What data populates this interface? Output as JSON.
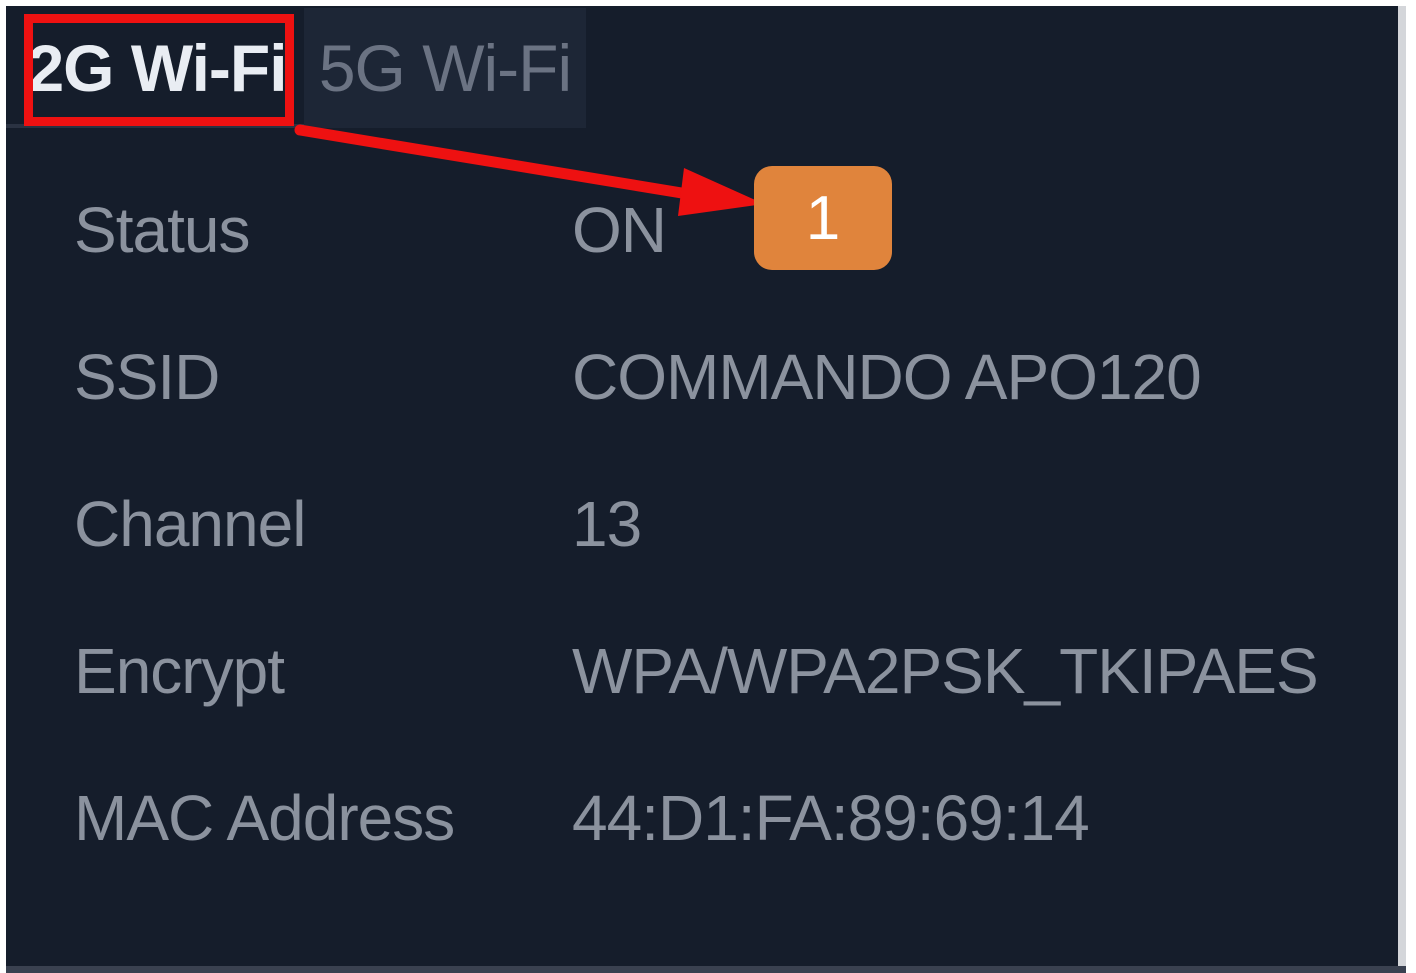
{
  "tabs": [
    {
      "label": "2G Wi-Fi",
      "active": true
    },
    {
      "label": "5G Wi-Fi",
      "active": false
    }
  ],
  "rows": [
    {
      "label": "Status",
      "value": "ON"
    },
    {
      "label": "SSID",
      "value": "COMMANDO APO120"
    },
    {
      "label": "Channel",
      "value": "13"
    },
    {
      "label": "Encrypt",
      "value": "WPA/WPA2PSK_TKIPAES"
    },
    {
      "label": "MAC Address",
      "value": "44:D1:FA:89:69:14"
    }
  ],
  "annotation": {
    "step_number": "1",
    "highlight_color": "#ee1111",
    "badge_color": "#e0843c"
  },
  "colors": {
    "panel_background": "#151d2b",
    "text": "#8b929e",
    "active_tab_text": "#e9edf3",
    "inactive_tab_background": "#1d2636"
  }
}
